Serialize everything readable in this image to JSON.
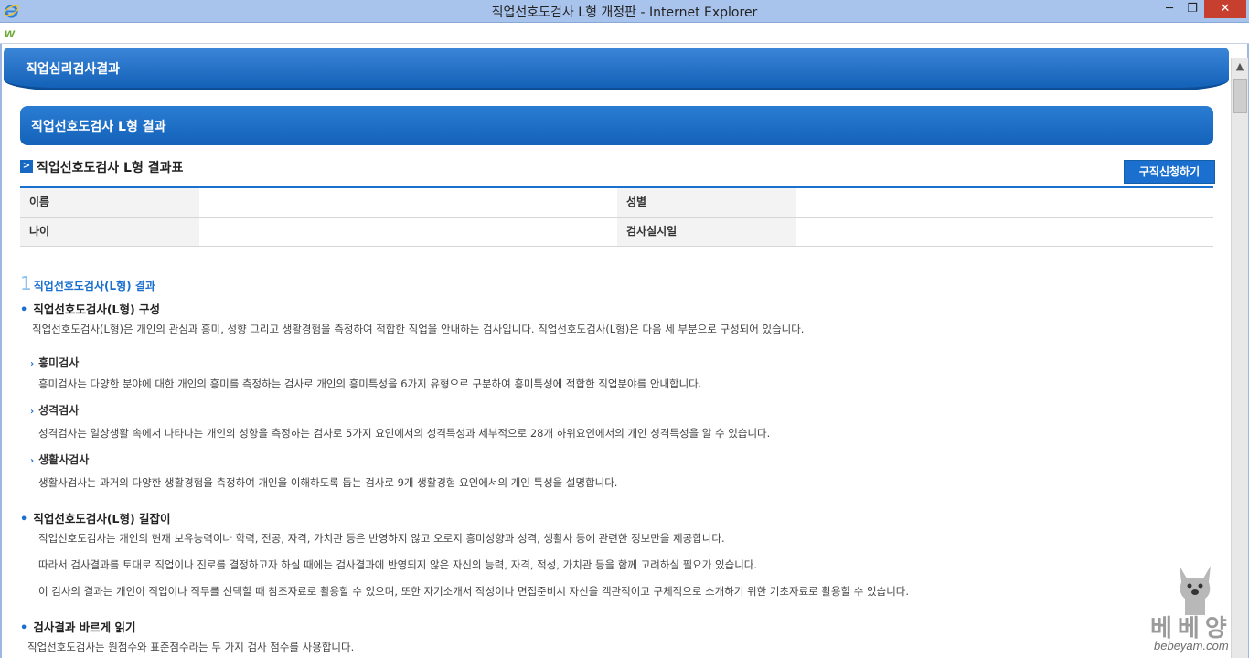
{
  "window": {
    "title": "직업선호도검사 L형 개정판 - Internet Explorer",
    "minimize_label": "─",
    "maximize_label": "❐",
    "close_label": "✕"
  },
  "page": {
    "header_title": "직업심리검사결과",
    "section_title": "직업선호도검사 L형 결과",
    "subhead_title": "직업선호도검사 L형 결과표",
    "apply_button": "구직신청하기"
  },
  "info_table": {
    "name_label": "이름",
    "gender_label": "성별",
    "age_label": "나이",
    "date_label": "검사실시일"
  },
  "results": {
    "number": "1",
    "heading": "직업선호도검사(L형) 결과",
    "composition": {
      "title": "직업선호도검사(L형) 구성",
      "text": "직업선호도검사(L형)은 개인의 관심과 흥미, 성향 그리고 생활경험을 측정하여 적합한 직업을 안내하는 검사입니다. 직업선호도검사(L형)은 다음 세 부분으로 구성되어 있습니다.",
      "items": [
        {
          "title": "흥미검사",
          "text": "흥미검사는 다양한 분야에 대한 개인의 흥미를 측정하는 검사로 개인의 흥미특성을 6가지 유형으로 구분하여 흥미특성에 적합한 직업분야를 안내합니다."
        },
        {
          "title": "성격검사",
          "text": "성격검사는 일상생활 속에서 나타나는 개인의 성향을 측정하는 검사로 5가지 요인에서의 성격특성과 세부적으로 28개 하위요인에서의 개인 성격특성을 알 수 있습니다."
        },
        {
          "title": "생활사검사",
          "text": "생활사검사는 과거의 다양한 생활경험을 측정하여 개인을 이해하도록 돕는 검사로 9개 생활경험 요인에서의 개인 특성을 설명합니다."
        }
      ]
    },
    "guide": {
      "title": "직업선호도검사(L형) 길잡이",
      "lines": [
        "직업선호도검사는 개인의 현재 보유능력이나 학력, 전공, 자격, 가치관 등은 반영하지 않고 오로지 흥미성향과 성격, 생활사 등에 관련한 정보만을 제공합니다.",
        "따라서 검사결과를 토대로 직업이나 진로를 결정하고자 하실 때에는 검사결과에 반영되지 않은 자신의 능력, 자격, 적성, 가치관 등을 함께 고려하실 필요가 있습니다.",
        "이 검사의 결과는 개인이 직업이나 직무를 선택할 때 참조자료로 활용할 수 있으며, 또한 자기소개서 작성이나 면접준비시 자신을 객관적이고 구체적으로 소개하기 위한 기초자료로 활용할 수 있습니다."
      ]
    },
    "reading": {
      "title": "검사결과 바르게 읽기",
      "text": "직업선호도검사는 원점수와 표준점수라는 두 가지 검사 점수를 사용합니다."
    }
  },
  "watermark": {
    "text": "베베양",
    "url": "bebeyam.com"
  },
  "icons": {
    "app_logo": "ie-logo-icon",
    "toolbar_logo": "w-logo-icon",
    "subhead": "chevron-right-icon",
    "scroll_up": "chevron-up-icon"
  },
  "colors": {
    "primary_blue": "#1a6fcf",
    "header_blue": "#1361b8",
    "close_red": "#c7402f"
  }
}
